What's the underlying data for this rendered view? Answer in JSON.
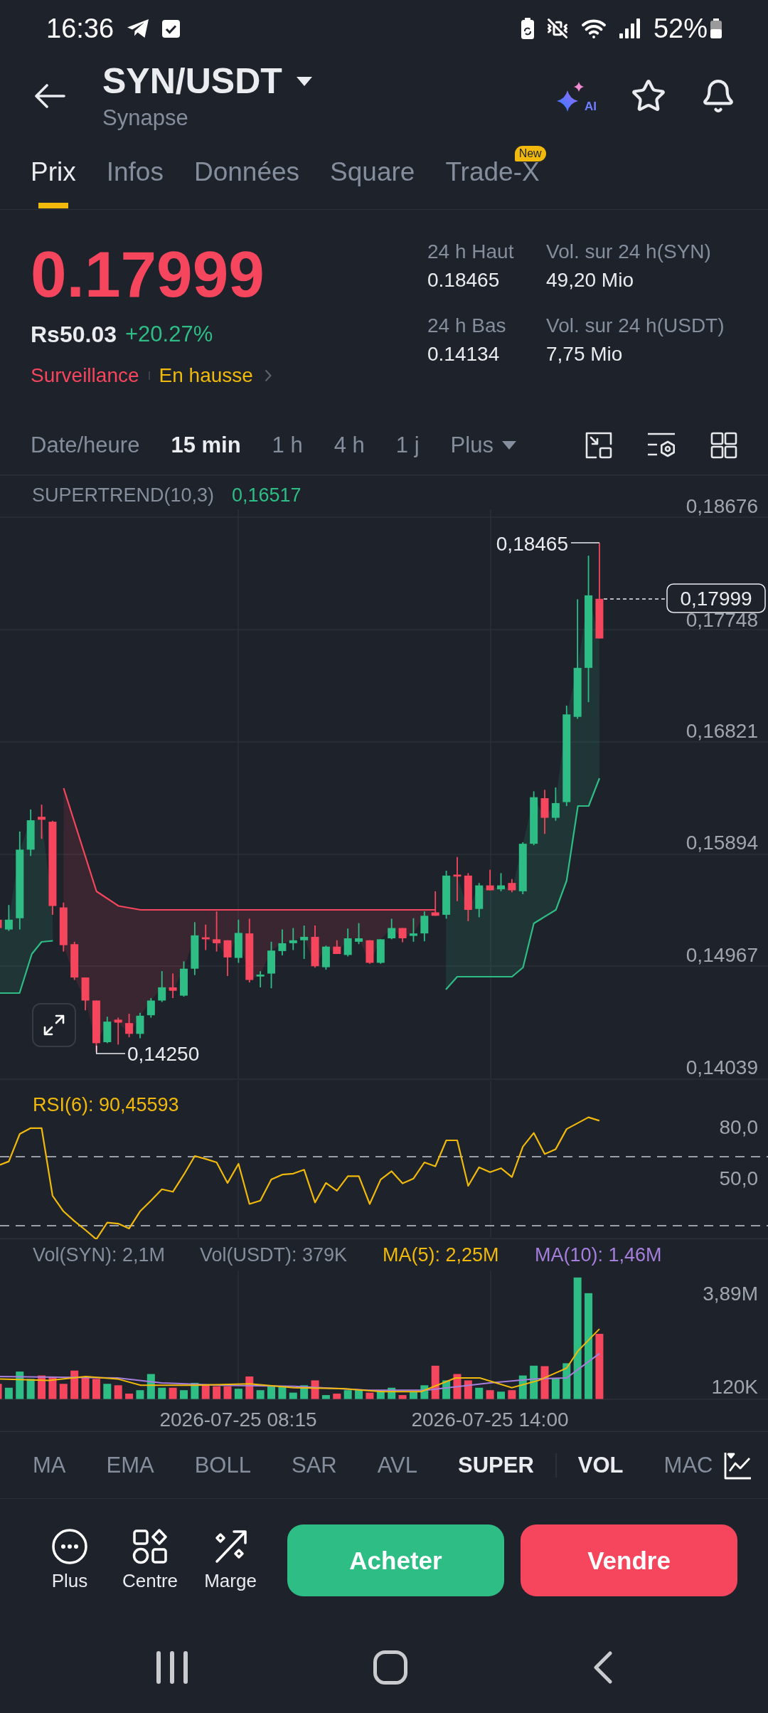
{
  "status_bar": {
    "time": "16:36",
    "battery": "52%"
  },
  "header": {
    "pair": "SYN/USDT",
    "name": "Synapse",
    "ai_label": "AI"
  },
  "tabs": [
    {
      "label": "Prix",
      "selected": true
    },
    {
      "label": "Infos",
      "selected": false
    },
    {
      "label": "Données",
      "selected": false
    },
    {
      "label": "Square",
      "selected": false
    },
    {
      "label": "Trade-X",
      "selected": false,
      "badge": "New"
    }
  ],
  "price": {
    "last": "0.17999",
    "local": "Rs50.03",
    "change": "+20.27%",
    "tags": [
      {
        "label": "Surveillance",
        "color": "#f6465d"
      },
      {
        "label": "En hausse",
        "color": "#f0b90b"
      }
    ]
  },
  "stats": [
    {
      "label": "24 h Haut",
      "value": "0.18465"
    },
    {
      "label": "Vol. sur 24 h(SYN)",
      "value": "49,20 Mio"
    },
    {
      "label": "24 h Bas",
      "value": "0.14134"
    },
    {
      "label": "Vol. sur 24 h(USDT)",
      "value": "7,75 Mio"
    }
  ],
  "intervals": [
    {
      "label": "Date/heure",
      "selected": false
    },
    {
      "label": "15 min",
      "selected": true
    },
    {
      "label": "1 h",
      "selected": false
    },
    {
      "label": "4 h",
      "selected": false
    },
    {
      "label": "1 j",
      "selected": false
    }
  ],
  "more_intervals": "Plus",
  "chart": {
    "legend": {
      "name": "SUPERTREND(10,3)",
      "value": "0,16517"
    },
    "price_axis": [
      "0,18676",
      "0,17748",
      "0,16821",
      "0,15894",
      "0,14967",
      "0,14039"
    ],
    "high_label": "0,18465",
    "low_label": "0,14250",
    "current_price": "0,17999"
  },
  "rsi": {
    "legend": "RSI(6): 90,45593",
    "axis": [
      "80,0",
      "50,0"
    ]
  },
  "volume": {
    "legend": [
      {
        "text": "Vol(SYN): 2,1M",
        "color": "#848e9c"
      },
      {
        "text": "Vol(USDT): 379K",
        "color": "#848e9c"
      },
      {
        "text": "MA(5): 2,25M",
        "color": "#f0b90b"
      },
      {
        "text": "MA(10): 1,46M",
        "color": "#a67fdc"
      }
    ],
    "axis": [
      "3,89M",
      "120K"
    ]
  },
  "time_axis": [
    "2026-07-25 08:15",
    "2026-07-25 14:00"
  ],
  "indicator_groups": [
    {
      "items": [
        {
          "label": "MA",
          "selected": false
        },
        {
          "label": "EMA",
          "selected": false
        },
        {
          "label": "BOLL",
          "selected": false
        },
        {
          "label": "SAR",
          "selected": false
        },
        {
          "label": "AVL",
          "selected": false
        },
        {
          "label": "SUPER",
          "selected": true
        }
      ]
    },
    {
      "items": [
        {
          "label": "VOL",
          "selected": true
        },
        {
          "label": "MAC",
          "selected": false
        }
      ]
    }
  ],
  "actions": [
    {
      "label": "Plus"
    },
    {
      "label": "Centre"
    },
    {
      "label": "Marge"
    }
  ],
  "trade_buttons": [
    {
      "label": "Acheter",
      "kind": "buy"
    },
    {
      "label": "Vendre",
      "kind": "sell"
    }
  ]
}
